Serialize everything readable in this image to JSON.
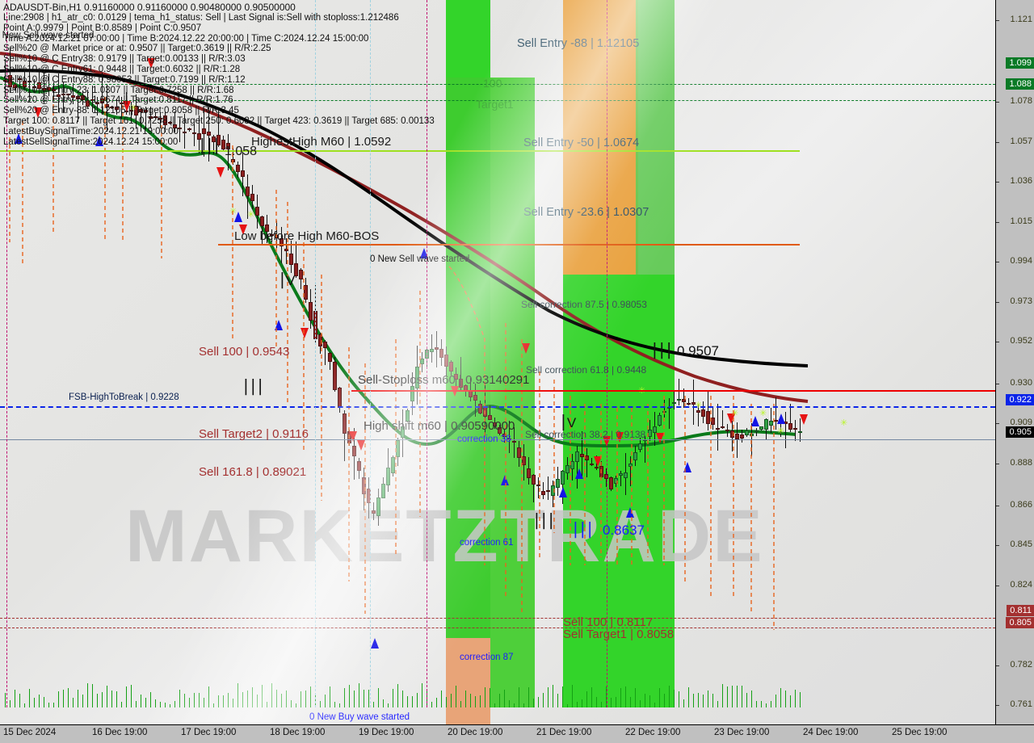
{
  "symbol_header": "ADAUSDT-Bin,H1   0.91160000 0.91160000 0.90480000 0.90500000",
  "info_lines": [
    "Line:2908 | h1_atr_c0: 0.0129 | tema_h1_status: Sell | Last Signal is:Sell with stoploss:1.212486",
    "Point A:0.9979 | Point B:0.8589 | Point C:0.9507",
    "Time A:2024.12.21 07:00:00 | Time B:2024.12.22 20:00:00 | Time C:2024.12.24 15:00:00",
    "Sell%20 @ Market price or at: 0.9507 || Target:0.3619 || R/R:2.25",
    "Sell%10 @ C Entry38: 0.9179 || Target:0.00133 || R/R:3.03",
    "Sell%10 @ C Entry61: 0.9448 || Target:0.6032 || R/R:1.28",
    "Sell%10 @ C Entry88: 0.98053 || Target:0.7199 || R/R:1.12",
    "Sell%10 @ Entry-23: 1.0307 || Target:0.7258 || R/R:1.68",
    "Sell%20 @ Entry-50: 1.0674 || Target:0.8117 || R/R:1.76",
    "Sell%20 @ Entry-88: 1.12105 || Target:0.8058 || R/R:3.45",
    "Target 100: 0.8117 || Target 161: 0.7258 || Target 250: 0.6032 || Target 423: 0.3619 || Target 685: 0.00133",
    "LatestBuySignalTime:2024.12.21 19:00:00",
    "LatestSellSignalTime:2024.12.24 15:00:00"
  ],
  "overlay_left_text": "0 New Sell wave started",
  "annotations": {
    "sell_entry_88": "Sell Entry -88 | 1.12105",
    "band_100": "100",
    "band_target1": "Target1",
    "sell_entry_50": "Sell Entry -50 | 1.0674",
    "sell_entry_236": "Sell Entry -23.6 | 1.0307",
    "highest_high": "HighestHigh   M60 | 1.0592",
    "high_1058": "1.058",
    "low_before_high": "Low before High   M60-BOS",
    "new_sell_wave": "0 New Sell wave started",
    "sell_corr_875": "Sell correction 87.5 | 0.98053",
    "sell_corr_618": "Sell correction 61.8 | 0.9448",
    "ll_09507": "0.9507",
    "sell_100_09543": "Sell 100 | 0.9543",
    "sell_stoploss": "Sell-Stoploss m60 | 0.93140291",
    "fsb_high_to_break": "FSB-HighToBreak | 0.9228",
    "sell_target2": "Sell Target2 | 0.9116",
    "high_shift_m60": "High shift m60 | 0.90590000",
    "correction_38": "correction 38",
    "sell_corr_382": "Sell correction 38.2 | 0.9138",
    "sell_1618": "Sell 161.8 | 0.89021",
    "correction_61": "correction 61",
    "ll_08637": "0.8637",
    "sell_100_08117": "Sell 100 | 0.8117",
    "sell_target1": "Sell Target1 | 0.8058",
    "correction_87": "correction 87",
    "new_buy_wave": "0 New Buy wave started"
  },
  "chart_data": {
    "type": "line",
    "title": "ADAUSDT-Bin,H1",
    "xlabel": "",
    "ylabel": "",
    "ylim": [
      0.7505,
      1.1315
    ],
    "xlim": [
      "15 Dec 2024",
      "25 Dec 19:00"
    ],
    "y_ticks": [
      "1.121",
      "1.099",
      "1.088",
      "1.078",
      "1.057",
      "1.036",
      "1.015",
      "0.994",
      "0.973",
      "0.952",
      "0.930",
      "0.922",
      "0.909",
      "0.905",
      "0.888",
      "0.866",
      "0.845",
      "0.824",
      "0.811",
      "0.805",
      "0.782",
      "0.761"
    ],
    "x_ticks": [
      "15 Dec 2024",
      "16 Dec 19:00",
      "17 Dec 19:00",
      "18 Dec 19:00",
      "19 Dec 19:00",
      "20 Dec 19:00",
      "21 Dec 19:00",
      "22 Dec 19:00",
      "23 Dec 19:00",
      "24 Dec 19:00",
      "25 Dec 19:00"
    ],
    "highlighted_prices": [
      {
        "value": "1.099",
        "color": "#0a7a26",
        "text_color": "#ffffff"
      },
      {
        "value": "1.088",
        "color": "#0a7a26",
        "text_color": "#ffffff"
      },
      {
        "value": "0.922",
        "color": "#0a24e8",
        "text_color": "#ffffff"
      },
      {
        "value": "0.905",
        "color": "#000000",
        "text_color": "#ffffff"
      },
      {
        "value": "0.811",
        "color": "#a33030",
        "text_color": "#ffffff"
      },
      {
        "value": "0.805",
        "color": "#a33030",
        "text_color": "#ffffff"
      }
    ],
    "levels": [
      {
        "name": "Sell Entry -88",
        "price": 1.12105,
        "color": "#2a4a6a",
        "style": "none"
      },
      {
        "name": "100",
        "price": 1.099,
        "color": "#0a7a26",
        "style": "dashed"
      },
      {
        "name": "Target1",
        "price": 1.088,
        "color": "#0a7a26",
        "style": "dashed"
      },
      {
        "name": "Sell Entry -50",
        "price": 1.0674,
        "color": "#9ee020",
        "style": "solid"
      },
      {
        "name": "HighestHigh M60",
        "price": 1.0592,
        "color": "#9ee020",
        "style": "solid"
      },
      {
        "name": "Sell Entry -23.6",
        "price": 1.0307,
        "color": "#e03c10",
        "style": "solid"
      },
      {
        "name": "Low before High M60-BOS",
        "price": 1.0155,
        "color": "#e05a10",
        "style": "solid"
      },
      {
        "name": "Sell-Stoploss m60",
        "price": 0.93140291,
        "color": "#ee0000",
        "style": "solid"
      },
      {
        "name": "FSB-HighToBreak",
        "price": 0.9228,
        "color": "#0a24e8",
        "style": "dashed"
      },
      {
        "name": "High shift m60",
        "price": 0.9059,
        "color": "#556677",
        "style": "solid"
      },
      {
        "name": "Sell 100",
        "price": 0.8117,
        "color": "#a33030",
        "style": "dashed"
      },
      {
        "name": "Sell Target1",
        "price": 0.8058,
        "color": "#a33030",
        "style": "dashed"
      }
    ],
    "bands": [
      {
        "label": "100 / Target1",
        "color": "#33d42a",
        "x_start": 552,
        "x_end": 660
      },
      {
        "label": "orange-zone",
        "color": "#e9a03c",
        "x_start": 697,
        "x_end": 790
      },
      {
        "label": "green-zone-2",
        "color": "#33d42a",
        "x_start": 787,
        "x_end": 880
      },
      {
        "label": "correction 87",
        "color": "#e8a478",
        "x_start": 552,
        "x_end": 660
      },
      {
        "label": "correction 61",
        "color": "#33d42a",
        "x_start": 552,
        "x_end": 660
      }
    ],
    "series": [
      {
        "name": "MA-black",
        "color": "#000000"
      },
      {
        "name": "MA-darkred",
        "color": "#8f2020"
      },
      {
        "name": "MA-green",
        "color": "#0a7a1a"
      }
    ]
  }
}
